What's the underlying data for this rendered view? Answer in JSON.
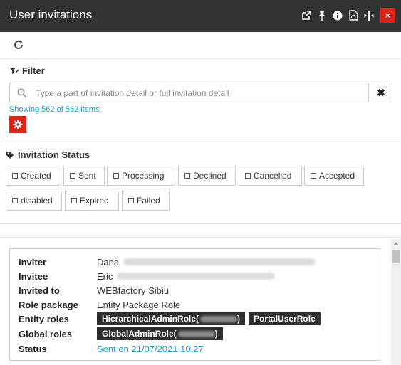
{
  "window": {
    "title": "User invitations",
    "icons": [
      "export-icon",
      "pin-icon",
      "info-icon",
      "pdf-icon",
      "resize-icon",
      "close-icon"
    ],
    "close_label": "×"
  },
  "toolbar": {
    "refresh_icon": "refresh-icon"
  },
  "filter": {
    "label": "Filter",
    "search_placeholder": "Type a part of invitation detail or full invitation detail",
    "search_value": "",
    "clear_label": "✖",
    "showing_text": "Showing 562 of 562 items"
  },
  "status_filter": {
    "title": "Invitation Status",
    "options": [
      "Created",
      "Sent",
      "Processing",
      "Declined",
      "Cancelled",
      "Accepted",
      "disabled",
      "Expired",
      "Failed"
    ]
  },
  "invitation": {
    "labels": {
      "inviter": "Inviter",
      "invitee": "Invitee",
      "invited_to": "Invited to",
      "role_package": "Role package",
      "entity_roles": "Entity roles",
      "global_roles": "Global roles",
      "status": "Status"
    },
    "inviter_name": "Dana",
    "invitee_name": "Eric",
    "invited_to": "WEBfactory Sibiu",
    "role_package": "Entity Package Role",
    "entity_roles": [
      "HierarchicalAdminRole(",
      "PortalUserRole"
    ],
    "entity_role_suffix": ")",
    "global_roles": [
      "GlobalAdminRole("
    ],
    "global_role_suffix": ")",
    "status": "Sent on 21/07/2021 10:27"
  },
  "colors": {
    "titlebar": "#323232",
    "accent_red": "#d9241b",
    "link_blue": "#1a9bd7"
  }
}
